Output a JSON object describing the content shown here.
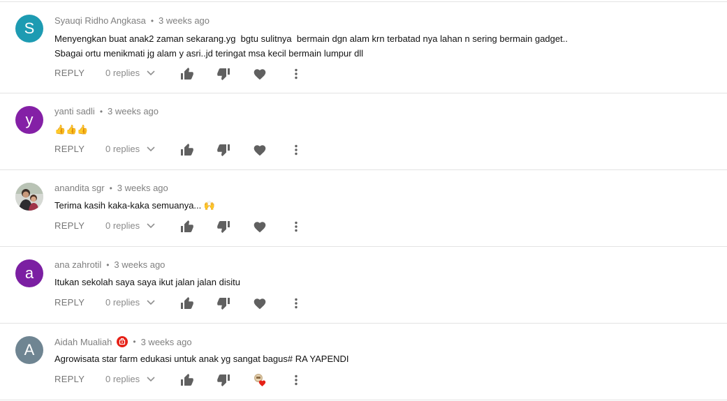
{
  "comments": [
    {
      "author": "Syauqi Ridho Angkasa",
      "time": "3 weeks ago",
      "avatar_letter": "S",
      "avatar_color": "#1d9bb2",
      "text_lines": [
        "Menyengkan buat anak2 zaman sekarang.yg  bgtu sulitnya  bermain dgn alam krn terbatad nya lahan n sering bermain gadget..",
        "Sbagai ortu menikmati jg alam y asri..jd teringat msa kecil bermain lumpur dll"
      ],
      "reply_label": "REPLY",
      "replies_label": "0 replies"
    },
    {
      "author": "yanti sadli",
      "time": "3 weeks ago",
      "avatar_letter": "y",
      "avatar_color": "#8420a6",
      "text_lines": [
        "👍👍👍"
      ],
      "reply_label": "REPLY",
      "replies_label": "0 replies"
    },
    {
      "author": "anandita sgr",
      "time": "3 weeks ago",
      "avatar_letter": "",
      "avatar_color": "#c9c9c9",
      "text_lines": [
        "Terima kasih kaka-kaka semuanya... 🙌"
      ],
      "reply_label": "REPLY",
      "replies_label": "0 replies"
    },
    {
      "author": "ana zahrotil",
      "time": "3 weeks ago",
      "avatar_letter": "a",
      "avatar_color": "#7b1fa2",
      "text_lines": [
        "Itukan sekolah saya saya ikut jalan jalan disitu"
      ],
      "reply_label": "REPLY",
      "replies_label": "0 replies"
    },
    {
      "author": "Aidah Mualiah",
      "time": "3 weeks ago",
      "avatar_letter": "A",
      "avatar_color": "#6f8592",
      "text_lines": [
        "Agrowisata star farm edukasi untuk anak yg sangat bagus# RA YAPENDI"
      ],
      "reply_label": "REPLY",
      "replies_label": "0 replies"
    }
  ],
  "icons": {
    "thumb_up": "thumb-up-icon",
    "thumb_down": "thumb-down-icon",
    "heart": "heart-icon",
    "creator_heart": "creator-heart-icon",
    "more": "more-vert-icon",
    "chevron": "chevron-down-icon",
    "badge": "channel-badge-icon"
  },
  "colors": {
    "icon_gray": "#606060",
    "meta_gray": "#7f7f7f",
    "badge_red": "#e62117"
  }
}
